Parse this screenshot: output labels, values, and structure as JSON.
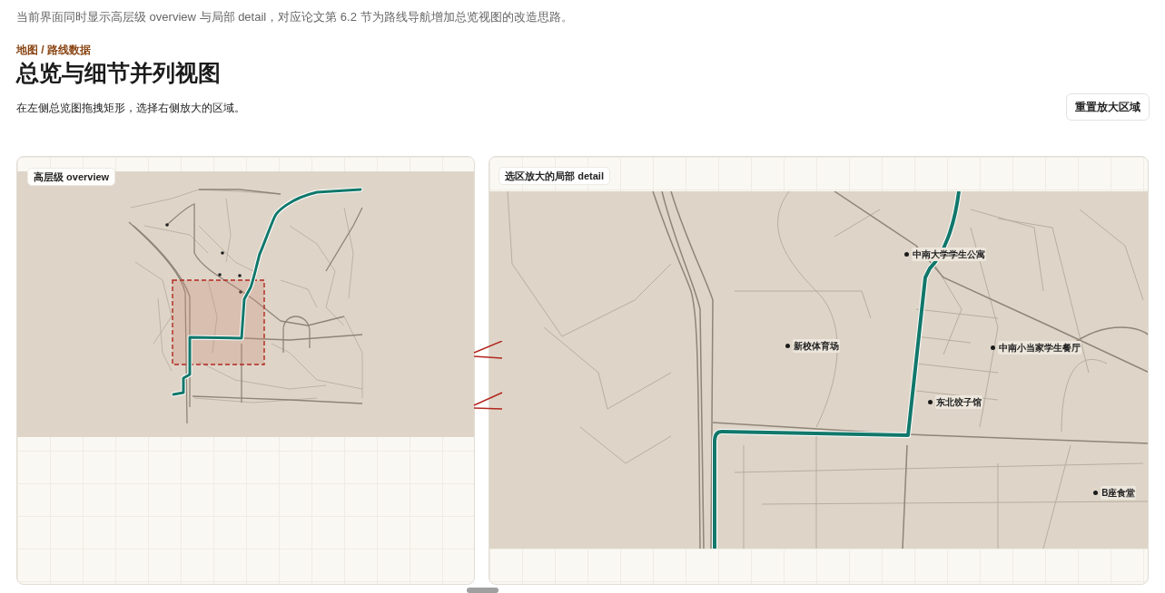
{
  "intro": "当前界面同时显示高层级 overview 与局部 detail，对应论文第 6.2 节为路线导航增加总览视图的改造思路。",
  "breadcrumb": "地图 / 路线数据",
  "title": "总览与细节并列视图",
  "subtitle": "在左侧总览图拖拽矩形，选择右侧放大的区域。",
  "reset_button": "重置放大区域",
  "overview": {
    "label": "高层级 overview"
  },
  "detail": {
    "label": "选区放大的局部 detail",
    "places": [
      {
        "name": "中南大学学生公寓"
      },
      {
        "name": "新校体育场"
      },
      {
        "name": "中南小当家学生餐厅"
      },
      {
        "name": "东北饺子馆"
      },
      {
        "name": "B座食堂"
      }
    ]
  }
}
